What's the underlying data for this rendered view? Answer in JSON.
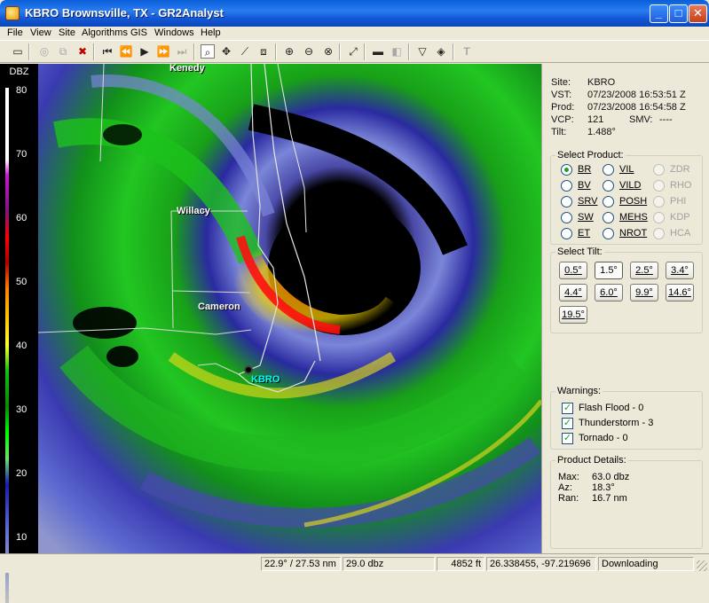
{
  "window": {
    "title": "KBRO Brownsville, TX - GR2Analyst",
    "min_glyph": "_",
    "max_glyph": "□",
    "close_glyph": "✕"
  },
  "menu": [
    "File",
    "View",
    "Site",
    "Algorithms",
    "GIS",
    "Windows",
    "Help"
  ],
  "toolbar_icons": [
    "open-icon",
    "copy-icon",
    "paste-icon",
    "delete-icon",
    "first-frame-icon",
    "step-back-icon",
    "play-icon",
    "step-forward-icon",
    "last-frame-icon",
    "zoom-icon",
    "pan-icon",
    "measure-icon",
    "layers-icon",
    "zoom-in-icon",
    "zoom-out-icon",
    "zoom-reset-icon",
    "warning-tool-icon",
    "cross-section-icon",
    "isosurface-icon",
    "volume-icon",
    "storm-track-icon",
    "text-tool-icon"
  ],
  "scale": {
    "title": "DBZ",
    "labels": [
      "80",
      "70",
      "60",
      "50",
      "40",
      "30",
      "20",
      "10"
    ]
  },
  "map": {
    "places": [
      "Kenedy",
      "Willacy",
      "Cameron"
    ],
    "site_label": "KBRO"
  },
  "info": {
    "site_label": "Site:",
    "site_value": "KBRO",
    "vst_label": "VST:",
    "vst_value": "07/23/2008  16:53:51 Z",
    "prod_label": "Prod:",
    "prod_value": "07/23/2008  16:54:58 Z",
    "vcp_label": "VCP:",
    "vcp_value": "121",
    "smv_label": "SMV:",
    "smv_value": "----",
    "tilt_label": "Tilt:",
    "tilt_value": "1.488°"
  },
  "products": {
    "title": "Select Product:",
    "items": [
      {
        "label": "BR",
        "selected": true,
        "enabled": true
      },
      {
        "label": "VIL",
        "selected": false,
        "enabled": true
      },
      {
        "label": "ZDR",
        "selected": false,
        "enabled": false
      },
      {
        "label": "BV",
        "selected": false,
        "enabled": true
      },
      {
        "label": "VILD",
        "selected": false,
        "enabled": true
      },
      {
        "label": "RHO",
        "selected": false,
        "enabled": false
      },
      {
        "label": "SRV",
        "selected": false,
        "enabled": true
      },
      {
        "label": "POSH",
        "selected": false,
        "enabled": true
      },
      {
        "label": "PHI",
        "selected": false,
        "enabled": false
      },
      {
        "label": "SW",
        "selected": false,
        "enabled": true
      },
      {
        "label": "MEHS",
        "selected": false,
        "enabled": true
      },
      {
        "label": "KDP",
        "selected": false,
        "enabled": false
      },
      {
        "label": "ET",
        "selected": false,
        "enabled": true
      },
      {
        "label": "NROT",
        "selected": false,
        "enabled": true
      },
      {
        "label": "HCA",
        "selected": false,
        "enabled": false
      }
    ]
  },
  "tilts": {
    "title": "Select Tilt:",
    "items": [
      {
        "label": "0.5°",
        "selected": false
      },
      {
        "label": "1.5°",
        "selected": true
      },
      {
        "label": "2.5°",
        "selected": false
      },
      {
        "label": "3.4°",
        "selected": false
      },
      {
        "label": "4.4°",
        "selected": false
      },
      {
        "label": "6.0°",
        "selected": false
      },
      {
        "label": "9.9°",
        "selected": false
      },
      {
        "label": "14.6°",
        "selected": false
      },
      {
        "label": "19.5°",
        "selected": false
      }
    ]
  },
  "warnings": {
    "title": "Warnings:",
    "items": [
      {
        "label": "Flash Flood - 0",
        "checked": true
      },
      {
        "label": "Thunderstorm - 3",
        "checked": true
      },
      {
        "label": "Tornado - 0",
        "checked": true
      }
    ]
  },
  "details": {
    "title": "Product Details:",
    "max_label": "Max:",
    "max_value": "63.0 dbz",
    "az_label": "Az:",
    "az_value": "18.3°",
    "ran_label": "Ran:",
    "ran_value": "16.7 nm"
  },
  "status": {
    "azimuth_range": "22.9° / 27.53 nm",
    "value": "29.0 dbz",
    "height": "4852 ft",
    "coords": "26.338455, -97.219696",
    "state": "Downloading"
  },
  "colors": {
    "window_title": "#0b5bd6",
    "panel_bg": "#ece9d8",
    "site_label": "#00ffff"
  }
}
